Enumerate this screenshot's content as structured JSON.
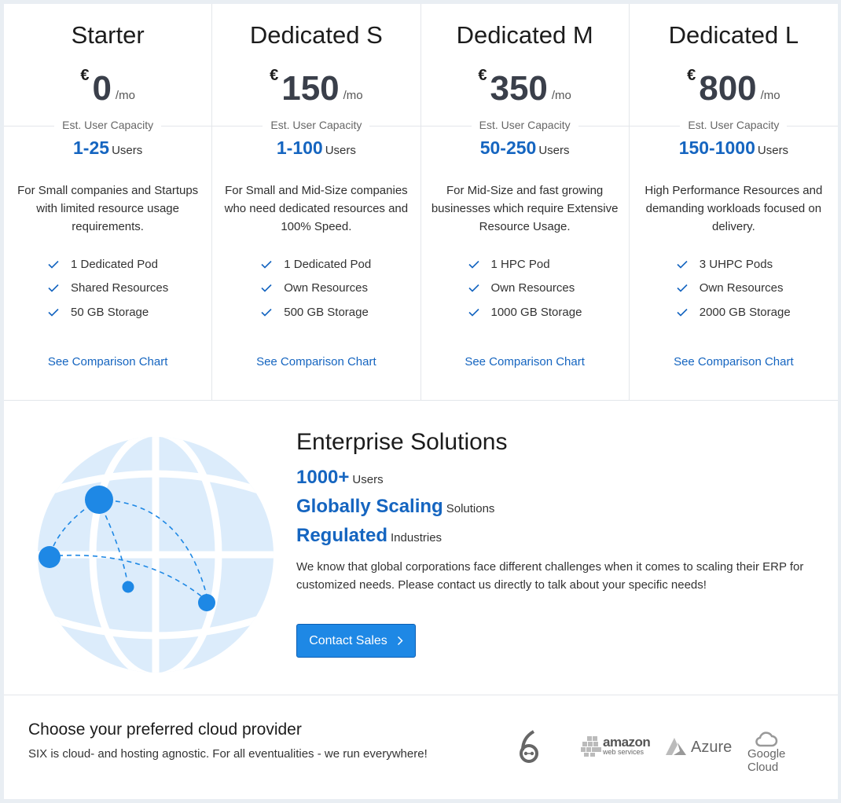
{
  "plans": [
    {
      "name": "Starter",
      "currency": "€",
      "price": "0",
      "unit": "/mo",
      "capacity_label": "Est. User Capacity",
      "users_range": "1-25",
      "users_label": "Users",
      "description": "For Small companies and Startups with limited resource usage requirements.",
      "features": [
        "1 Dedicated Pod",
        "Shared Resources",
        "50 GB Storage"
      ],
      "link": "See Comparison Chart"
    },
    {
      "name": "Dedicated S",
      "currency": "€",
      "price": "150",
      "unit": "/mo",
      "capacity_label": "Est. User Capacity",
      "users_range": "1-100",
      "users_label": "Users",
      "description": "For Small and Mid-Size companies who need dedicated resources and 100% Speed.",
      "features": [
        "1 Dedicated Pod",
        "Own Resources",
        "500 GB Storage"
      ],
      "link": "See Comparison Chart"
    },
    {
      "name": "Dedicated M",
      "currency": "€",
      "price": "350",
      "unit": "/mo",
      "capacity_label": "Est. User Capacity",
      "users_range": "50-250",
      "users_label": "Users",
      "description": "For Mid-Size and fast growing businesses which require Extensive Resource Usage.",
      "features": [
        "1 HPC Pod",
        "Own Resources",
        "1000 GB Storage"
      ],
      "link": "See Comparison Chart"
    },
    {
      "name": "Dedicated L",
      "currency": "€",
      "price": "800",
      "unit": "/mo",
      "capacity_label": "Est. User Capacity",
      "users_range": "150-1000",
      "users_label": "Users",
      "description": "High Performance Resources and demanding workloads focused on delivery.",
      "features": [
        "3 UHPC Pods",
        "Own Resources",
        "2000 GB Storage"
      ],
      "link": "See Comparison Chart"
    }
  ],
  "enterprise": {
    "title": "Enterprise Solutions",
    "highlights": [
      {
        "strong": "1000+",
        "label": "Users"
      },
      {
        "strong": "Globally Scaling",
        "label": "Solutions"
      },
      {
        "strong": "Regulated",
        "label": "Industries"
      }
    ],
    "description": "We know that global corporations face different challenges when it comes to scaling their ERP for customized needs. Please contact us directly to talk about your specific needs!",
    "button_label": "Contact Sales"
  },
  "cloud": {
    "title": "Choose your preferred cloud provider",
    "subtitle": "SIX is cloud- and hosting agnostic. For all eventualities - we run everywhere!",
    "providers": {
      "aws_main": "amazon",
      "aws_sub": "web services",
      "azure": "Azure",
      "google": "Google Cloud"
    }
  },
  "colors": {
    "accent": "#1565c0",
    "button": "#1e88e5",
    "globe_fill": "#dcecfb",
    "node": "#1e88e5"
  },
  "icons": {
    "feature_check": "check-icon",
    "button_chevron": "chevron-right-icon",
    "globe": "globe-network-icon"
  }
}
